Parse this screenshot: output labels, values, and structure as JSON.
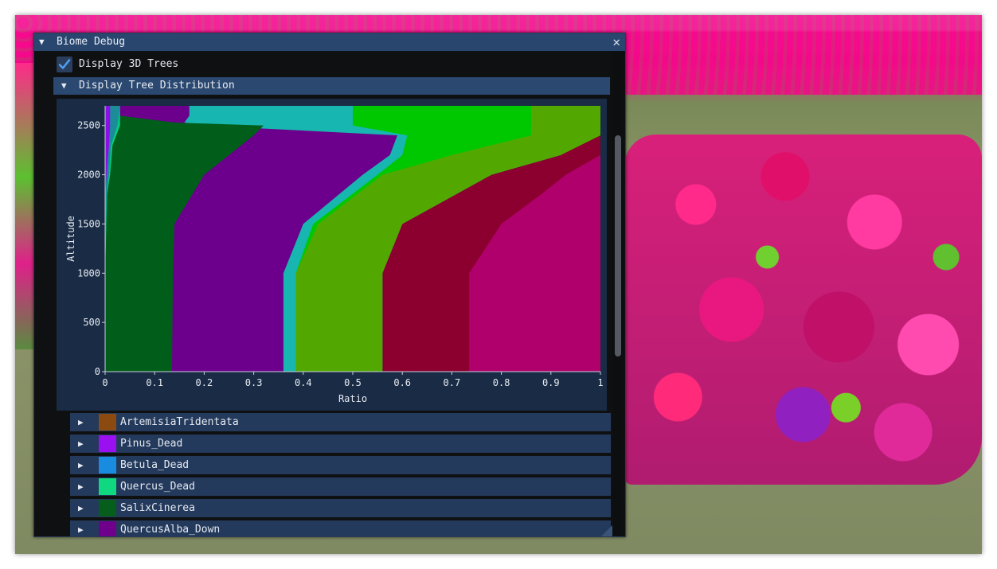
{
  "window": {
    "title": "Biome Debug",
    "close_glyph": "✕",
    "collapse_glyph": "▼"
  },
  "checkbox": {
    "label": "Display 3D Trees",
    "checked": true,
    "icon": "check-icon"
  },
  "distribution_header": {
    "label": "Display Tree Distribution",
    "expand_glyph": "▼"
  },
  "chart_data": {
    "type": "area",
    "title": "",
    "xlabel": "Ratio",
    "ylabel": "Altitude",
    "xlim": [
      0,
      1
    ],
    "ylim": [
      0,
      2700
    ],
    "xticks": [
      "0",
      "0.1",
      "0.2",
      "0.3",
      "0.4",
      "0.5",
      "0.6",
      "0.7",
      "0.8",
      "0.9",
      "1"
    ],
    "yticks": [
      "0",
      "500",
      "1000",
      "1500",
      "2000",
      "2500"
    ],
    "grid": false,
    "stacking": "cumulative boundaries (left to right)",
    "boundaries": [
      {
        "color": "#8b10e8",
        "altitude": [
          0,
          1000,
          1800,
          2000,
          2300,
          2500,
          2700
        ],
        "ratio": [
          0.0,
          0.0,
          0.0,
          0.003,
          0.008,
          0.01,
          0.01
        ]
      },
      {
        "color": "#1c8c9a",
        "altitude": [
          0,
          1000,
          1800,
          2000,
          2300,
          2500,
          2700
        ],
        "ratio": [
          0.0,
          0.0,
          0.003,
          0.008,
          0.012,
          0.025,
          0.03
        ]
      },
      {
        "color": "#00d080",
        "altitude": [
          0,
          1000,
          1800,
          2000,
          2300,
          2500,
          2700
        ],
        "ratio": [
          0.0,
          0.0,
          0.004,
          0.01,
          0.015,
          0.03,
          0.03
        ]
      },
      {
        "color": "#005e1a",
        "altitude": [
          0,
          1000,
          1500,
          2000,
          2400,
          2500,
          2530,
          2600,
          2700
        ],
        "ratio": [
          0.135,
          0.137,
          0.14,
          0.2,
          0.3,
          0.32,
          0.14,
          0.03,
          0.03
        ]
      },
      {
        "color": "#6c008c",
        "altitude": [
          0,
          1000,
          1500,
          2000,
          2200,
          2400,
          2500,
          2530,
          2600,
          2700
        ],
        "ratio": [
          0.36,
          0.36,
          0.4,
          0.52,
          0.575,
          0.59,
          0.2,
          0.16,
          0.17,
          0.17
        ]
      },
      {
        "color": "#18b6b0",
        "altitude": [
          0,
          1000,
          1500,
          2000,
          2200,
          2400,
          2500,
          2700
        ],
        "ratio": [
          0.385,
          0.385,
          0.42,
          0.55,
          0.6,
          0.61,
          0.5,
          0.5
        ]
      },
      {
        "color": "#00c800",
        "altitude": [
          0,
          1000,
          1500,
          2000,
          2200,
          2400,
          2500,
          2600,
          2700
        ],
        "ratio": [
          0.385,
          0.385,
          0.43,
          0.56,
          0.7,
          0.86,
          0.86,
          0.86,
          0.86
        ]
      },
      {
        "color": "#52a800",
        "altitude": [
          0,
          1000,
          1500,
          2000,
          2200,
          2400,
          2500,
          2700
        ],
        "ratio": [
          0.56,
          0.56,
          0.6,
          0.78,
          0.92,
          1.0,
          1.0,
          1.0
        ]
      },
      {
        "color": "#00a0b0",
        "altitude": [
          0,
          1000,
          1500,
          2000,
          2200,
          2700
        ],
        "ratio": [
          0.56,
          0.56,
          0.6,
          0.78,
          0.92,
          0.92
        ]
      },
      {
        "color": "#8c0030",
        "altitude": [
          0,
          1000,
          1500,
          1800,
          2000,
          2200,
          2400,
          2700
        ],
        "ratio": [
          0.735,
          0.735,
          0.8,
          0.88,
          0.93,
          1.0,
          1.0,
          1.0
        ]
      },
      {
        "color": "#b0006c",
        "altitude": [
          0,
          1000,
          1500,
          1800,
          2000,
          2200,
          2700
        ],
        "ratio": [
          1.0,
          1.0,
          1.0,
          1.0,
          1.0,
          1.0,
          1.0
        ]
      }
    ]
  },
  "species": [
    {
      "name": "ArtemisiaTridentata",
      "color": "#8a4a10",
      "expand_glyph": "▶"
    },
    {
      "name": "Pinus_Dead",
      "color": "#9a10f0",
      "expand_glyph": "▶"
    },
    {
      "name": "Betula_Dead",
      "color": "#1a8ce0",
      "expand_glyph": "▶"
    },
    {
      "name": "Quercus_Dead",
      "color": "#10d880",
      "expand_glyph": "▶"
    },
    {
      "name": "SalixCinerea",
      "color": "#065e1c",
      "expand_glyph": "▶"
    },
    {
      "name": "QuercusAlba_Down",
      "color": "#6e008c",
      "expand_glyph": "▶"
    }
  ]
}
